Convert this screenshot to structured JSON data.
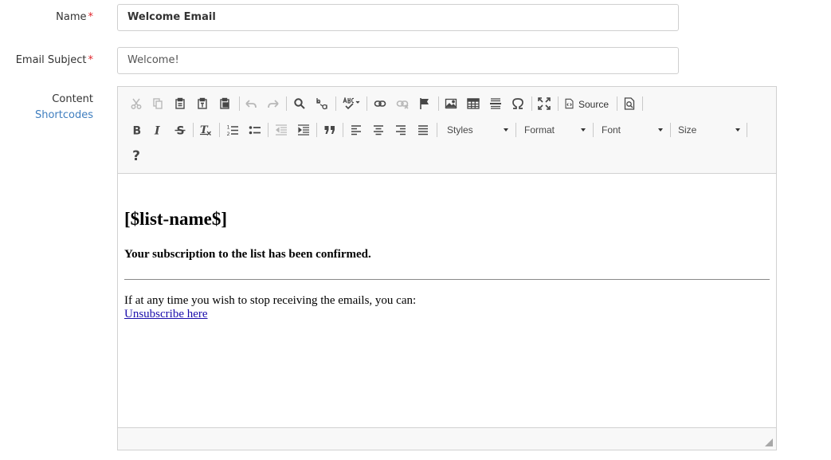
{
  "form": {
    "name_label": "Name",
    "name_value": "Welcome Email",
    "subject_label": "Email Subject",
    "subject_value": "Welcome!",
    "required_mark": "*",
    "content_label": "Content",
    "shortcodes_link": "Shortcodes"
  },
  "toolbar": {
    "source_label": "Source",
    "styles_label": "Styles",
    "format_label": "Format",
    "font_label": "Font",
    "size_label": "Size",
    "help_label": "?"
  },
  "editor": {
    "heading": "[$list-name$]",
    "confirmation": "Your subscription to the list has been confirmed.",
    "stop_text": "If at any time you wish to stop receiving the emails, you can:",
    "unsubscribe_link": "Unsubscribe here"
  },
  "colors": {
    "required": "#e0242b",
    "link": "#3f7ebf",
    "toolbar_bg": "#f8f8f8"
  }
}
